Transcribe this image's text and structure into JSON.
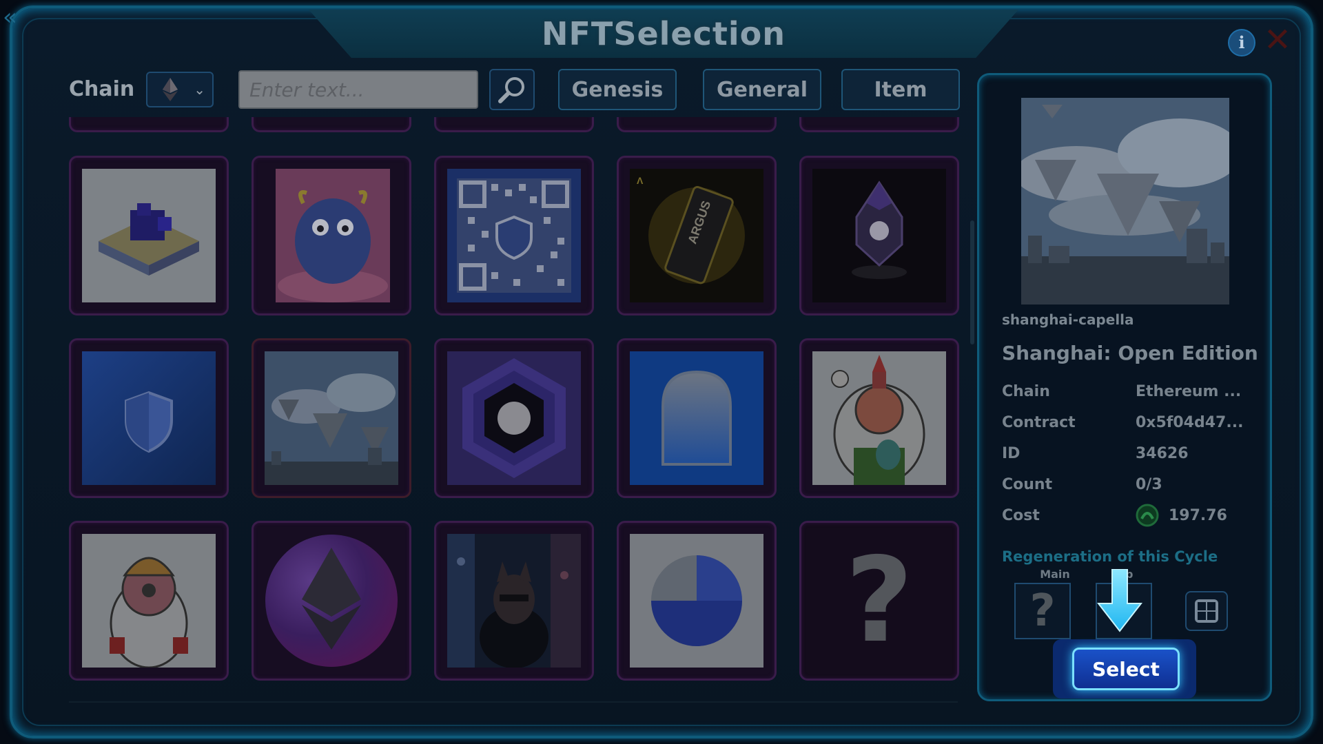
{
  "window": {
    "title": "NFTSelection",
    "back_icon": "«",
    "info_icon": "i",
    "close_icon": "✕"
  },
  "toolbar": {
    "chain_label": "Chain",
    "chain_selected_icon": "ethereum-icon",
    "search_placeholder": "Enter text...",
    "tabs": [
      "Genesis",
      "General",
      "Item"
    ]
  },
  "grid": {
    "items": [
      {
        "art": "voxel-building-island"
      },
      {
        "art": "blue-fluffy-monster"
      },
      {
        "art": "qr-code-shield"
      },
      {
        "art": "argus-card"
      },
      {
        "art": "dark-crystal-ship"
      },
      {
        "art": "blue-shield"
      },
      {
        "art": "floating-islands-city"
      },
      {
        "art": "hexagon-coin"
      },
      {
        "art": "blue-arch-door"
      },
      {
        "art": "astronaut-pencil-hat"
      },
      {
        "art": "astronaut-orange-hat"
      },
      {
        "art": "ethereum-purple-orb"
      },
      {
        "art": "cyberpunk-cat-mask"
      },
      {
        "art": "blue-half-circle"
      },
      {
        "art": "question-mark"
      }
    ],
    "question_glyph": "?"
  },
  "detail": {
    "slug": "shanghai-capella",
    "name": "Shanghai: Open Edition",
    "fields": [
      {
        "key": "Chain",
        "value": "Ethereum ..."
      },
      {
        "key": "Contract",
        "value": "0x5f04d47..."
      },
      {
        "key": "ID",
        "value": "34626"
      },
      {
        "key": "Count",
        "value": "0/3"
      },
      {
        "key": "Cost",
        "value": "197.76"
      }
    ],
    "regen_label": "Regeneration of this Cycle",
    "slot_main_label": "Main",
    "slot_sub_label": "ub",
    "slot_main_glyph": "?",
    "select_label": "Select"
  },
  "colors": {
    "accent": "#0f5b7a",
    "cell_border": "#3a1c4a",
    "select_button": "#1a52c8",
    "hint_arrow": "#2ec8ff"
  }
}
